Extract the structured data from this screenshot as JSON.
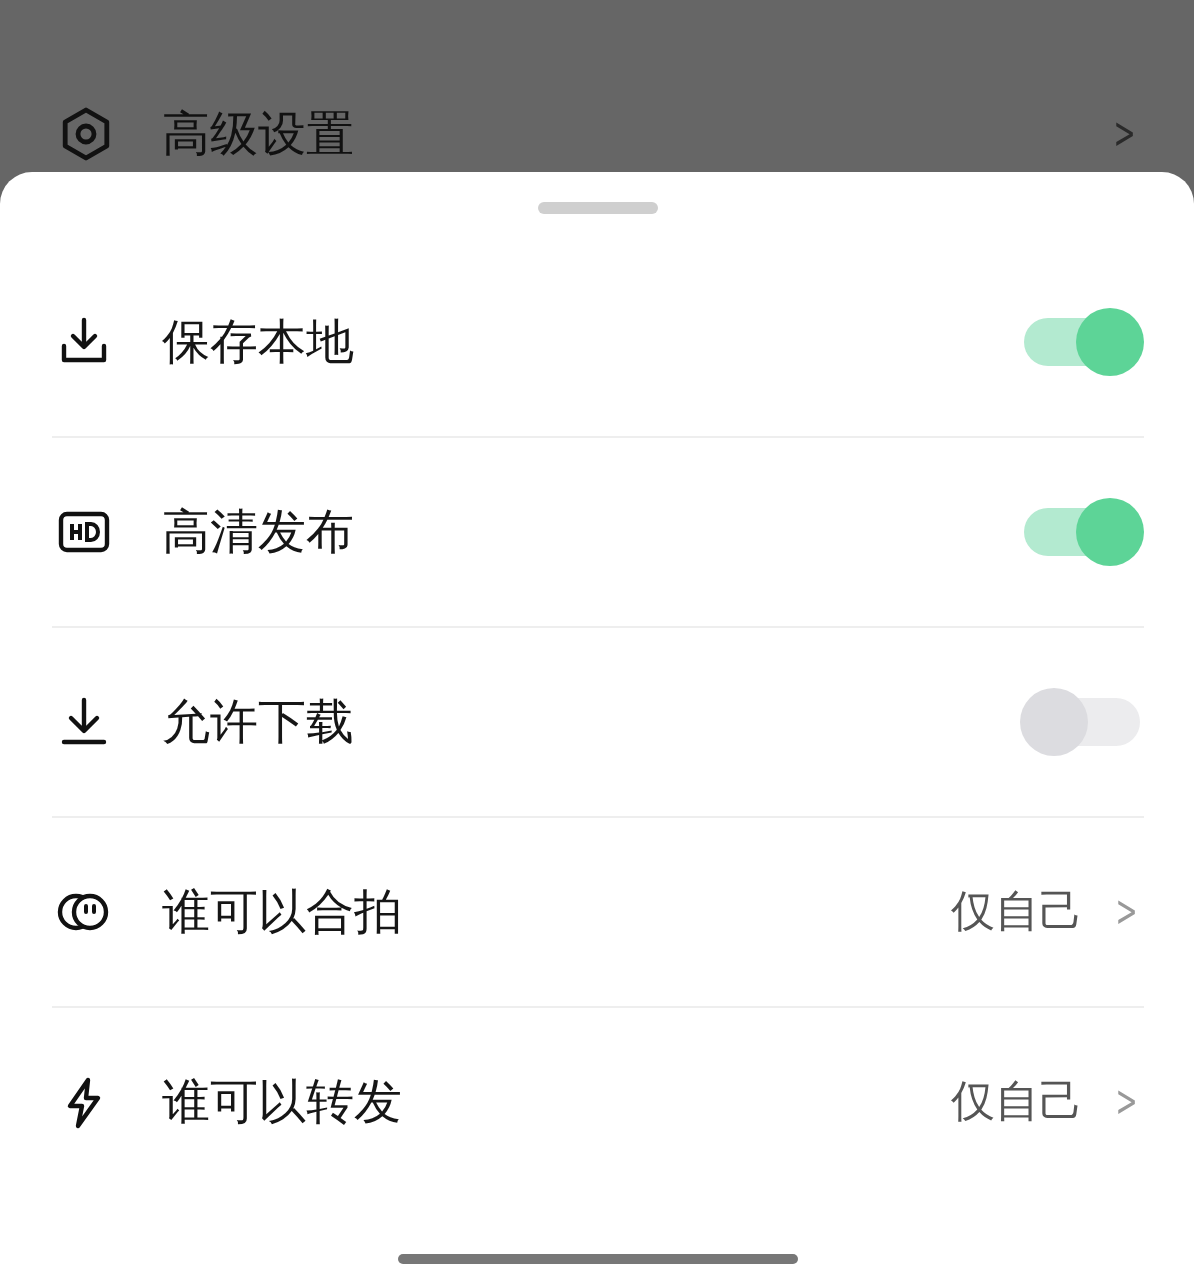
{
  "background_item": {
    "label": "高级设置",
    "chevron": ">"
  },
  "sheet": {
    "items": [
      {
        "kind": "toggle",
        "label": "保存本地",
        "on": true
      },
      {
        "kind": "toggle",
        "label": "高清发布",
        "on": true
      },
      {
        "kind": "toggle",
        "label": "允许下载",
        "on": false
      },
      {
        "kind": "link",
        "label": "谁可以合拍",
        "value": "仅自己",
        "chevron": ">"
      },
      {
        "kind": "link",
        "label": "谁可以转发",
        "value": "仅自己",
        "chevron": ">"
      }
    ]
  }
}
